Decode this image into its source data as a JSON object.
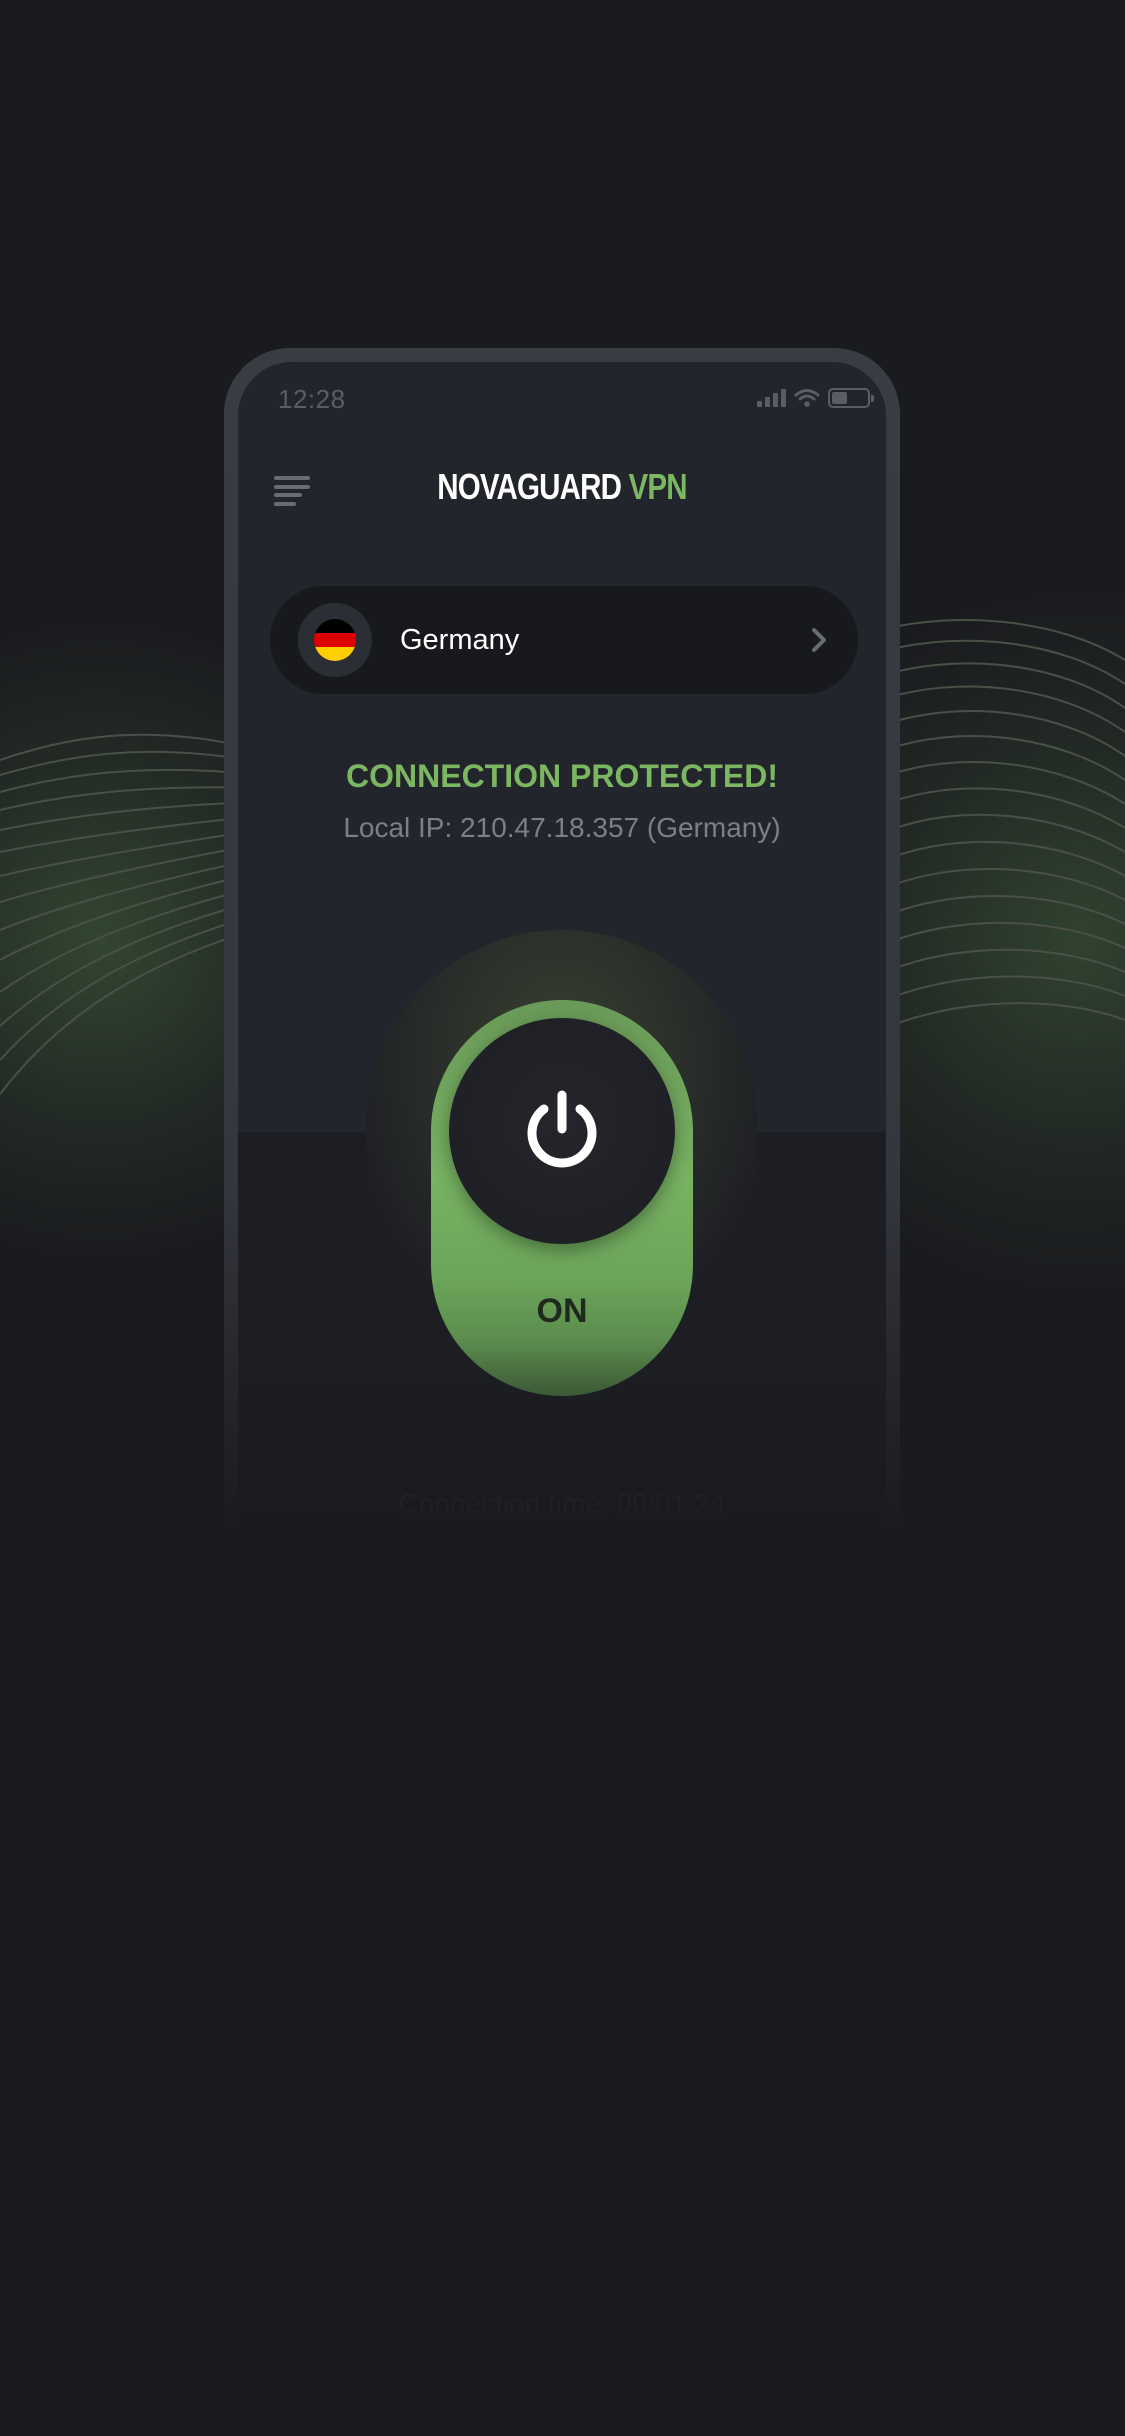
{
  "status_bar": {
    "time": "12:28"
  },
  "header": {
    "title_main": "NOVAGUARD",
    "title_accent": "VPN",
    "menu_icon": "menu-icon"
  },
  "country_selector": {
    "name": "Germany",
    "flag": "germany-flag-icon",
    "chevron": "chevron-right-icon"
  },
  "connection": {
    "status": "CONNECTION PROTECTED!",
    "local_ip": "Local IP: 210.47.18.357 (Germany)",
    "toggle_label": "ON",
    "time": "Connection time: 00:01:24"
  },
  "colors": {
    "background": "#1a1b1f",
    "screen_top": "#23252c",
    "accent_green": "#7bb661",
    "flag_black": "#000000",
    "flag_red": "#dd0000",
    "flag_gold": "#ffce00"
  }
}
